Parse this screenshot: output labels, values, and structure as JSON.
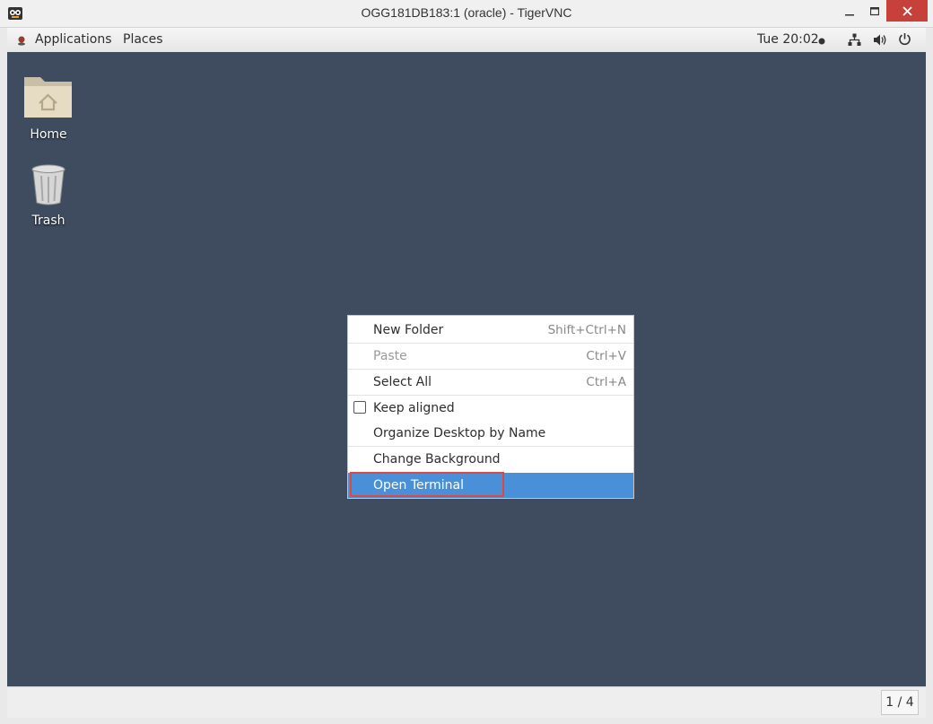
{
  "window": {
    "title": "OGG181DB183:1 (oracle) - TigerVNC",
    "min_icon": "minimize-icon",
    "max_icon": "maximize-icon",
    "close_icon": "close-icon"
  },
  "topbar": {
    "applications": "Applications",
    "places": "Places",
    "clock": "Tue 20:02"
  },
  "desktop": {
    "icons": [
      {
        "label": "Home",
        "icon": "home-folder-icon"
      },
      {
        "label": "Trash",
        "icon": "trash-icon"
      }
    ]
  },
  "menu": {
    "items": [
      {
        "label": "New Folder",
        "accel": "Shift+Ctrl+N"
      },
      {
        "label": "Paste",
        "accel": "Ctrl+V",
        "disabled": true
      },
      {
        "label": "Select All",
        "accel": "Ctrl+A"
      },
      {
        "label": "Keep aligned",
        "checkbox": true,
        "checked": false
      },
      {
        "label": "Organize Desktop by Name"
      },
      {
        "label": "Change Background"
      },
      {
        "label": "Open Terminal",
        "highlighted": true
      }
    ]
  },
  "bottombar": {
    "workspace": "1 / 4"
  },
  "colors": {
    "desktop_bg": "#3f4c60",
    "highlight": "#4a90d9",
    "annotation": "#e0483f",
    "close_button": "#c7413a"
  }
}
